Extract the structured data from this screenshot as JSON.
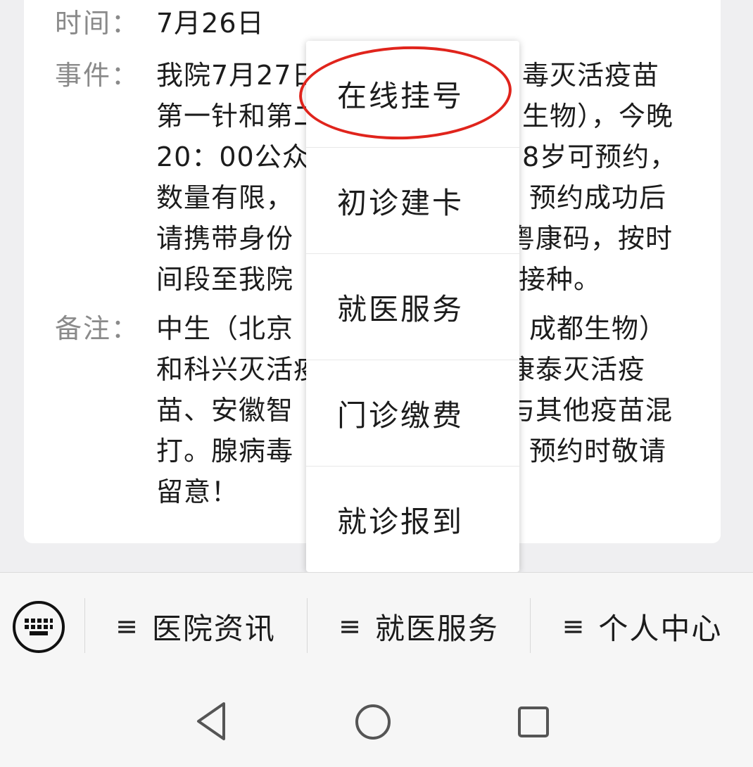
{
  "article": {
    "time": {
      "label": "时间：",
      "value": "7月26日"
    },
    "event": {
      "label": "事件：",
      "lines": [
        "我院7月27日",
        "第一针和第二",
        "20：00公众",
        "数量有限，",
        "请携带身份",
        "间段至我院"
      ],
      "lines_right": [
        "毒灭活疫苗",
        "生物），今晚",
        "8岁可预约，",
        "预约成功后",
        "粤康码，按时",
        "接种。"
      ]
    },
    "note": {
      "label": "备注：",
      "lines": [
        "中生（北京",
        "和科兴灭活疫",
        "苗、安徽智",
        "打。腺病毒",
        "留意！"
      ],
      "lines_right": [
        "成都生物）",
        "康泰灭活疫",
        "与其他疫苗混",
        "预约时敬请",
        ""
      ]
    }
  },
  "popup_menu": {
    "items": [
      "在线挂号",
      "初诊建卡",
      "就医服务",
      "门诊缴费",
      "就诊报到"
    ]
  },
  "bottom_menu": {
    "keyboard_icon": "keyboard-icon",
    "tabs": [
      {
        "burger": "≡",
        "label": "医院资讯"
      },
      {
        "burger": "≡",
        "label": "就医服务"
      },
      {
        "burger": "≡",
        "label": "个人中心"
      }
    ]
  },
  "colors": {
    "highlight": "#e0241c"
  }
}
